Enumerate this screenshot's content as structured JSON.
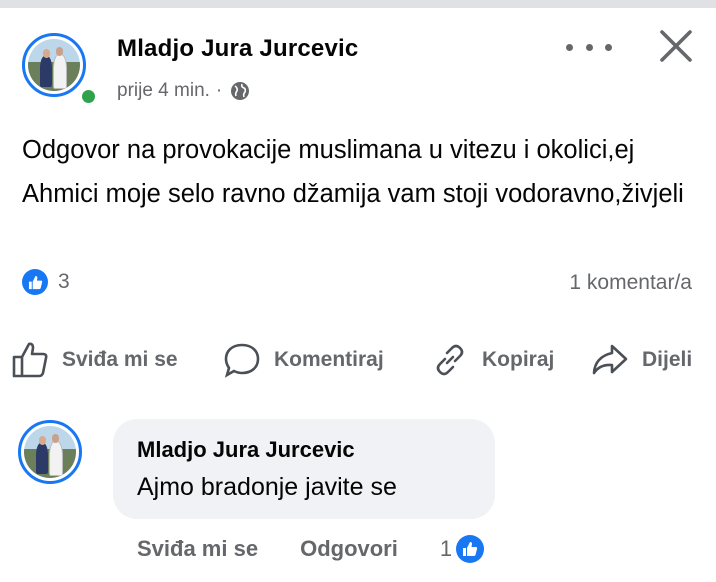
{
  "post": {
    "author": "Mladjo Jura Jurcevic",
    "time": "prije 4 min.",
    "separator": "·",
    "text": "Odgovor na provokacije muslimana u vitezu i okolici,ej Ahmici moje selo ravno džamija vam stoji vodoravno,živjeli",
    "reaction_count": "3",
    "comment_count": "1 komentar/a"
  },
  "actions": {
    "like": "Sviđa mi se",
    "comment": "Komentiraj",
    "copy": "Kopiraj",
    "share": "Dijeli"
  },
  "comment": {
    "author": "Mladjo Jura Jurcevic",
    "text": "Ajmo bradonje javite se",
    "like": "Sviđa mi se",
    "reply": "Odgovori",
    "like_count": "1"
  },
  "colors": {
    "accent": "#1877f2",
    "online": "#31a24c",
    "muted_text": "#65676b",
    "bubble": "#f0f2f5"
  },
  "icons": [
    "globe-icon",
    "more-icon",
    "close-icon",
    "like-icon",
    "comment-icon",
    "copy-icon",
    "share-icon"
  ]
}
